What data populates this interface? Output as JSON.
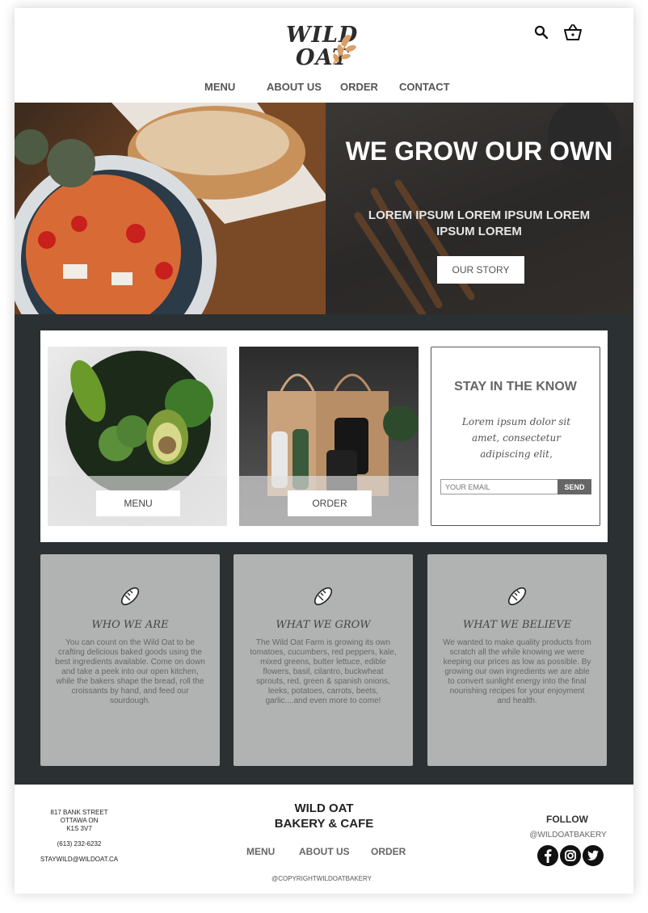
{
  "brand": {
    "logo_line1": "WILD",
    "logo_line2": "OAT",
    "leaf_color": "#d9a06b"
  },
  "header": {
    "icons": [
      "search-icon",
      "cart-icon"
    ]
  },
  "nav": {
    "items": [
      "MENU",
      "ABOUT US",
      "ORDER",
      "CONTACT"
    ]
  },
  "hero": {
    "title": "WE GROW OUR OWN",
    "subtitle": "LOREM IPSUM LOREM IPSUM LOREM IPSUM LOREM",
    "button": "OUR STORY"
  },
  "feature_cards": {
    "menu_button": "MENU",
    "order_button": "ORDER"
  },
  "newsletter": {
    "title": "STAY IN THE KNOW",
    "text": "Lorem ipsum dolor sit amet, consectetur adipiscing elit,",
    "placeholder": "YOUR EMAIL",
    "button": "SEND"
  },
  "info": [
    {
      "icon": "bread-icon",
      "title": "WHO WE ARE",
      "text": "You can count on the Wild Oat to be crafting delicious baked goods using the best ingredients available.  Come on down and take a peek into our open kitchen, while the bakers shape the bread, roll the croissants by hand, and feed our sourdough."
    },
    {
      "icon": "bread-icon",
      "title": "WHAT WE GROW",
      "text": "The Wild Oat Farm is growing its own tomatoes, cucumbers, red peppers, kale, mixed greens, butter lettuce, edible flowers, basil, cilantro, buckwheat sprouts, red, green & spanish onions, leeks, potatoes, carrots, beets, garlic....and even more to come!"
    },
    {
      "icon": "bread-icon",
      "title": "WHAT WE BELIEVE",
      "text": "We wanted to make quality products from scratch all the while knowing we were keeping our prices as low as possible. By growing our own ingredients we are able to convert sunlight energy into the final nourishing recipes for your enjoyment and health."
    }
  ],
  "footer": {
    "address_line1": "817 BANK STREET",
    "address_line2": "OTTAWA ON",
    "address_line3": "K1S 3V7",
    "phone": "(613) 232-6232",
    "email": "STAYWILD@WILDOAT.CA",
    "brand_line1": "WILD OAT",
    "brand_line2": "BAKERY & CAFE",
    "nav": [
      "MENU",
      "ABOUT US",
      "ORDER"
    ],
    "copyright": "@COPYRIGHTWILDOATBAKERY",
    "follow": "FOLLOW",
    "handle": "@WILDOATBAKERY",
    "social_icons": [
      "facebook-icon",
      "instagram-icon",
      "twitter-icon"
    ]
  }
}
